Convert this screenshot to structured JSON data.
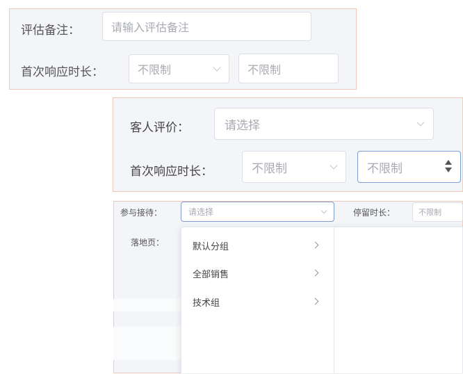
{
  "panel1": {
    "remark_label": "评估备注：",
    "remark_placeholder": "请输入评估备注",
    "response_label": "首次响应时长：",
    "response_select": "不限制",
    "response_input": "不限制"
  },
  "panel2": {
    "rating_label": "客人评价：",
    "rating_select": "请选择",
    "response_label": "首次响应时长：",
    "response_select": "不限制",
    "response_input": "不限制"
  },
  "panel3": {
    "reception_label": "参与接待：",
    "reception_select": "请选择",
    "dwell_label": "停留时长：",
    "dwell_input": "不限制",
    "landing_label": "落地页：",
    "dropdown_items": [
      {
        "label": "默认分组"
      },
      {
        "label": "全部销售"
      },
      {
        "label": "技术组"
      }
    ]
  },
  "colors": {
    "panel_border": "#f2c8b6",
    "panel_bg": "#f3f5f9",
    "focus_border": "#7f9bd0"
  }
}
